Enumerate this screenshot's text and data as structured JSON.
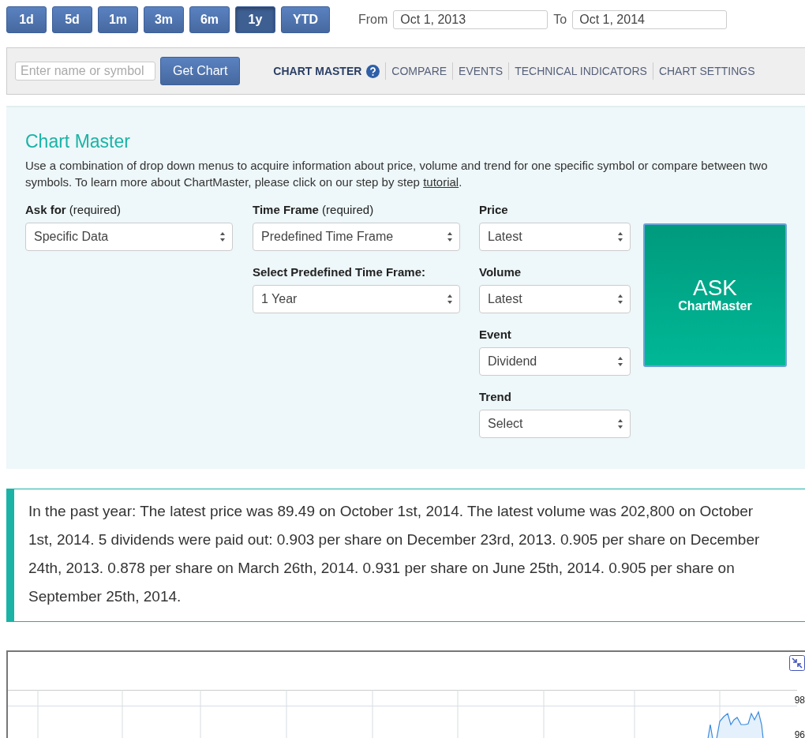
{
  "ranges": [
    {
      "label": "1d",
      "selected": false
    },
    {
      "label": "5d",
      "selected": false
    },
    {
      "label": "1m",
      "selected": false
    },
    {
      "label": "3m",
      "selected": false
    },
    {
      "label": "6m",
      "selected": false
    },
    {
      "label": "1y",
      "selected": true
    },
    {
      "label": "YTD",
      "selected": false
    }
  ],
  "dates": {
    "from_label": "From",
    "from": "Oct 1, 2013",
    "to_label": "To",
    "to": "Oct 1, 2014"
  },
  "toolbar": {
    "search_placeholder": "Enter name or symbol",
    "button": "Get Chart",
    "tabs": [
      {
        "label": "CHART MASTER",
        "selected": true,
        "help": true
      },
      {
        "label": "COMPARE",
        "selected": false,
        "help": false
      },
      {
        "label": "EVENTS",
        "selected": false,
        "help": false
      },
      {
        "label": "TECHNICAL INDICATORS",
        "selected": false,
        "help": false
      },
      {
        "label": "CHART SETTINGS",
        "selected": false,
        "help": false
      }
    ]
  },
  "panel": {
    "title": "Chart Master",
    "description": {
      "before": "Use a combination of drop down menus to acquire information about price, volume and trend for one specific symbol or compare between two symbols. To learn more about ChartMaster, please click on our step by step ",
      "link": "tutorial",
      "after": "."
    },
    "columns": [
      [
        {
          "label": "**Ask for** (required)",
          "value": "Specific Data"
        }
      ],
      [
        {
          "label": "**Time Frame** (required)",
          "value": "Predefined Time Frame"
        },
        {
          "label": "Select Predefined Time Frame:",
          "value": "1 Year"
        }
      ],
      [
        {
          "label": "Price",
          "value": "Latest"
        },
        {
          "label": "Volume",
          "value": "Latest"
        },
        {
          "label": "Event",
          "value": "Dividend"
        },
        {
          "label": "Trend",
          "value": "Select"
        }
      ]
    ],
    "ask_button": {
      "title": "ASK",
      "subtitle": "ChartMaster"
    }
  },
  "result": "In the past year: The latest price was 89.49 on October 1st, 2014. The latest volume was 202,800 on October 1st, 2014. 5 dividends were paid out: 0.903 per share on December 23rd, 2013. 0.905 per share on December 24th, 2013. 0.878 per share on March 26th, 2014. 0.931 per share on June 25th, 2014. 0.905 per share on September 25th, 2014.",
  "chart": {
    "axis_labels": [
      "98",
      "96"
    ]
  }
}
